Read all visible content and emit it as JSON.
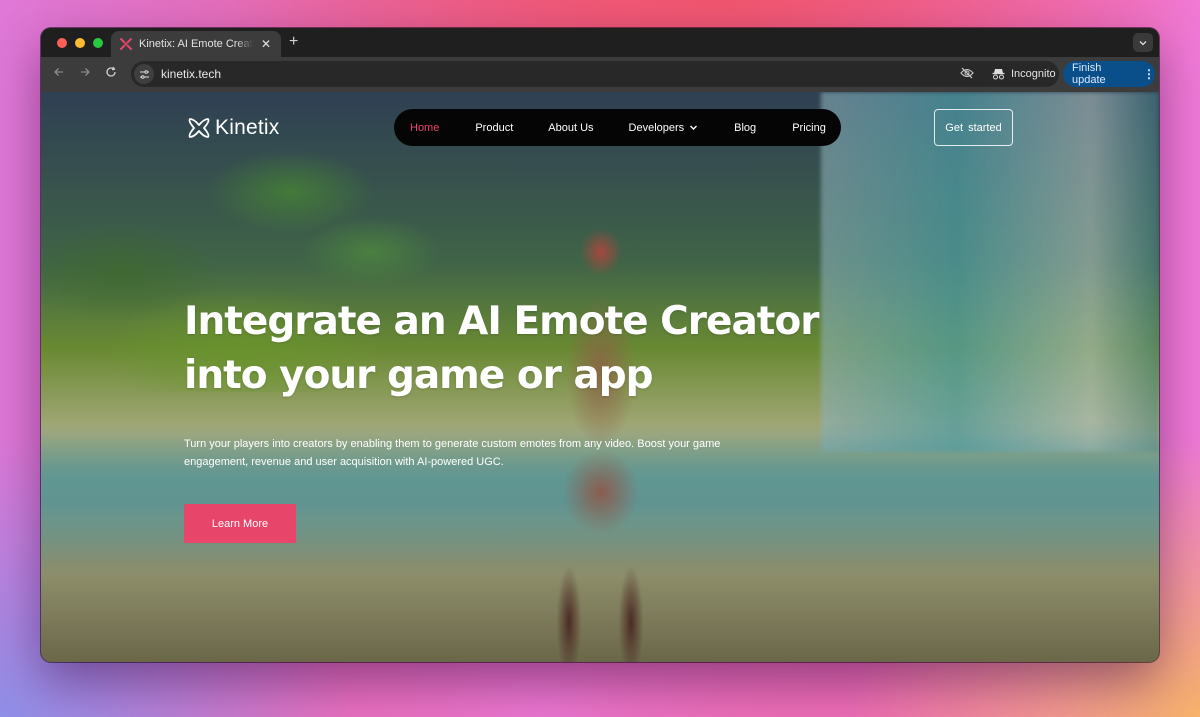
{
  "browser": {
    "tab_title": "Kinetix: AI Emote Creator: Boost",
    "url": "kinetix.tech",
    "new_tab_symbol": "+",
    "close_symbol": "✕",
    "incognito_label": "Incognito",
    "update_label": "Finish update",
    "icons": {
      "back": "back-arrow-icon",
      "forward": "forward-arrow-icon",
      "reload": "reload-icon",
      "site_info": "tune-icon",
      "eye_off": "eye-off-icon",
      "bookmark": "star-icon",
      "incognito": "incognito-icon",
      "menu": "kebab-menu-icon",
      "tab_search": "chevron-down-icon"
    },
    "colors": {
      "update_button": "#0b4f8a",
      "traffic_close": "#ff5f57",
      "traffic_minimize": "#febc2e",
      "traffic_maximize": "#28c840"
    }
  },
  "site": {
    "logo_text": "Kinetix",
    "nav": {
      "items": [
        {
          "label": "Home",
          "active": true
        },
        {
          "label": "Product",
          "active": false
        },
        {
          "label": "About Us",
          "active": false
        },
        {
          "label": "Developers",
          "active": false,
          "has_dropdown": true
        },
        {
          "label": "Blog",
          "active": false
        },
        {
          "label": "Pricing",
          "active": false
        }
      ]
    },
    "get_started_label": "Get started",
    "hero": {
      "title_line1": "Integrate an AI Emote Creator",
      "title_line2": "into your game or app",
      "subtitle": "Turn your players into creators by enabling them to generate custom emotes from any video. Boost your game engagement, revenue and user acquisition with AI-powered UGC.",
      "cta_label": "Learn More"
    },
    "colors": {
      "accent": "#e8456a",
      "nav_bg": "#050505",
      "text": "#ffffff"
    }
  }
}
